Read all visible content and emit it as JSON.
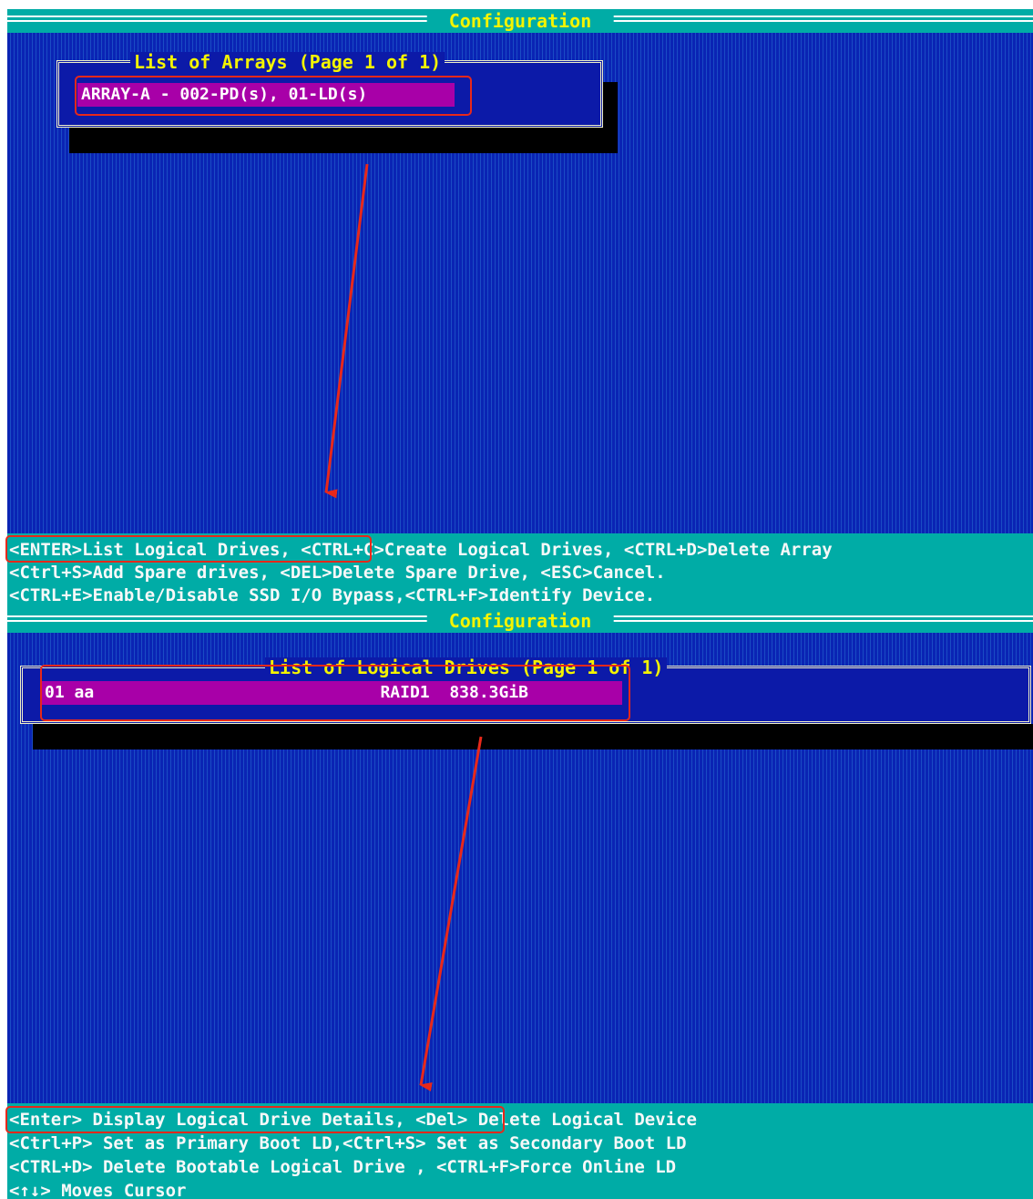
{
  "top": {
    "title": " Configuration ",
    "panel_title": "List of Arrays (Page 1 of 1)",
    "selected_item": "ARRAY-A - 002-PD(s), 01-LD(s)",
    "help": [
      "<ENTER>List Logical Drives, <CTRL+C>Create Logical Drives, <CTRL+D>Delete Array",
      "<Ctrl+S>Add Spare drives, <DEL>Delete Spare Drive, <ESC>Cancel.",
      "<CTRL+E>Enable/Disable SSD I/O Bypass,<CTRL+F>Identify Device."
    ]
  },
  "bottom": {
    "title": " Configuration ",
    "panel_title": "List of Logical Drives (Page 1 of 1)",
    "selected_item": "01 aa                             RAID1  838.3GiB",
    "help": [
      "<Enter> Display Logical Drive Details, <Del> Delete Logical Device",
      "<Ctrl+P> Set as Primary Boot LD,<Ctrl+S> Set as Secondary Boot LD",
      "<CTRL+D> Delete Bootable Logical Drive , <CTRL+F>Force Online LD",
      "<↑↓> Moves Cursor"
    ]
  },
  "colors": {
    "screen_bg": "#0a24b4",
    "bar_bg": "#00aca6",
    "title_text": "#f4f400",
    "selection_bg": "#a800a8",
    "annotation": "#e8281a"
  }
}
